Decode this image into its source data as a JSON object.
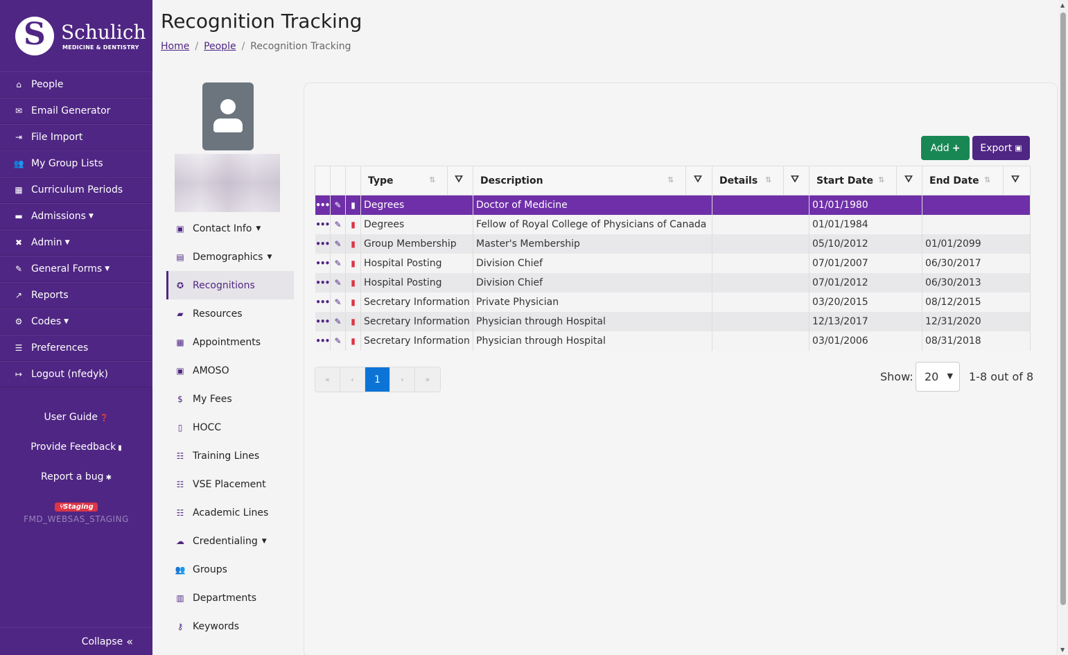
{
  "brand": {
    "mark": "S",
    "name": "Schulich",
    "subtitle": "MEDICINE & DENTISTRY"
  },
  "sidebar": {
    "items": [
      {
        "label": "People",
        "icon": "home-icon"
      },
      {
        "label": "Email Generator",
        "icon": "envelope-icon"
      },
      {
        "label": "File Import",
        "icon": "file-import-icon"
      },
      {
        "label": "My Group Lists",
        "icon": "users-icon"
      },
      {
        "label": "Curriculum Periods",
        "icon": "calendar-icon"
      },
      {
        "label": "Admissions",
        "icon": "keyboard-icon"
      },
      {
        "label": "Admin",
        "icon": "tools-icon"
      },
      {
        "label": "General Forms",
        "icon": "form-edit-icon"
      },
      {
        "label": "Reports",
        "icon": "chart-line-icon"
      },
      {
        "label": "Codes",
        "icon": "cogs-icon"
      },
      {
        "label": "Preferences",
        "icon": "sliders-icon"
      },
      {
        "label": "Logout (nfedyk)",
        "icon": "sign-out-icon"
      }
    ],
    "user_guide": "User Guide",
    "feedback": "Provide Feedback",
    "bug": "Report a bug",
    "staging_badge": "Staging",
    "env_name": "FMD_WEBSAS_STAGING",
    "collapse": "Collapse"
  },
  "header": {
    "title": "Recognition Tracking",
    "breadcrumb": [
      "Home",
      "People",
      "Recognition Tracking"
    ]
  },
  "profile_menu": [
    {
      "label": "Contact Info",
      "icon": "id-card-icon",
      "dropdown": true
    },
    {
      "label": "Demographics",
      "icon": "address-card-icon",
      "dropdown": true
    },
    {
      "label": "Recognitions",
      "icon": "award-icon",
      "active": true
    },
    {
      "label": "Resources",
      "icon": "folder-open-icon"
    },
    {
      "label": "Appointments",
      "icon": "calendar-check-icon"
    },
    {
      "label": "AMOSO",
      "icon": "user-box-icon"
    },
    {
      "label": "My Fees",
      "icon": "invoice-dollar-icon"
    },
    {
      "label": "HOCC",
      "icon": "file-alt-icon"
    },
    {
      "label": "Training Lines",
      "icon": "table-icon"
    },
    {
      "label": "VSE Placement",
      "icon": "table-icon"
    },
    {
      "label": "Academic Lines",
      "icon": "table-icon"
    },
    {
      "label": "Credentialing",
      "icon": "cloud-user-icon",
      "dropdown": true
    },
    {
      "label": "Groups",
      "icon": "users-group-icon"
    },
    {
      "label": "Departments",
      "icon": "building-icon"
    },
    {
      "label": "Keywords",
      "icon": "key-icon"
    }
  ],
  "toolbar": {
    "add_label": "Add",
    "export_label": "Export"
  },
  "table": {
    "columns": [
      "Type",
      "Description",
      "Details",
      "Start Date",
      "End Date"
    ],
    "rows": [
      {
        "type": "Degrees",
        "description": "Doctor of Medicine",
        "details": "",
        "start": "01/01/1980",
        "end": "",
        "selected": true
      },
      {
        "type": "Degrees",
        "description": "Fellow of Royal College of Physicians of Canada",
        "details": "",
        "start": "01/01/1984",
        "end": ""
      },
      {
        "type": "Group Membership",
        "description": "Master's Membership",
        "details": "",
        "start": "05/10/2012",
        "end": "01/01/2099"
      },
      {
        "type": "Hospital Posting",
        "description": "Division Chief",
        "details": "",
        "start": "07/01/2007",
        "end": "06/30/2017"
      },
      {
        "type": "Hospital Posting",
        "description": "Division Chief",
        "details": "",
        "start": "07/01/2012",
        "end": "06/30/2013"
      },
      {
        "type": "Secretary Information",
        "description": "Private Physician",
        "details": "",
        "start": "03/20/2015",
        "end": "08/12/2015"
      },
      {
        "type": "Secretary Information",
        "description": "Physician through Hospital",
        "details": "",
        "start": "12/13/2017",
        "end": "12/31/2020"
      },
      {
        "type": "Secretary Information",
        "description": "Physician through Hospital",
        "details": "",
        "start": "03/01/2006",
        "end": "08/31/2018"
      }
    ]
  },
  "pagination": {
    "first": "«",
    "prev": "‹",
    "current": "1",
    "next": "›",
    "last": "»"
  },
  "page_size": {
    "label": "Show:",
    "value": "20",
    "summary": "1-8 out of 8"
  },
  "colors": {
    "brand_purple": "#4f2683",
    "selected_row": "#6f2fa8",
    "add_green": "#198754",
    "active_page": "#0b74d6",
    "delete_red": "#dc3545"
  }
}
